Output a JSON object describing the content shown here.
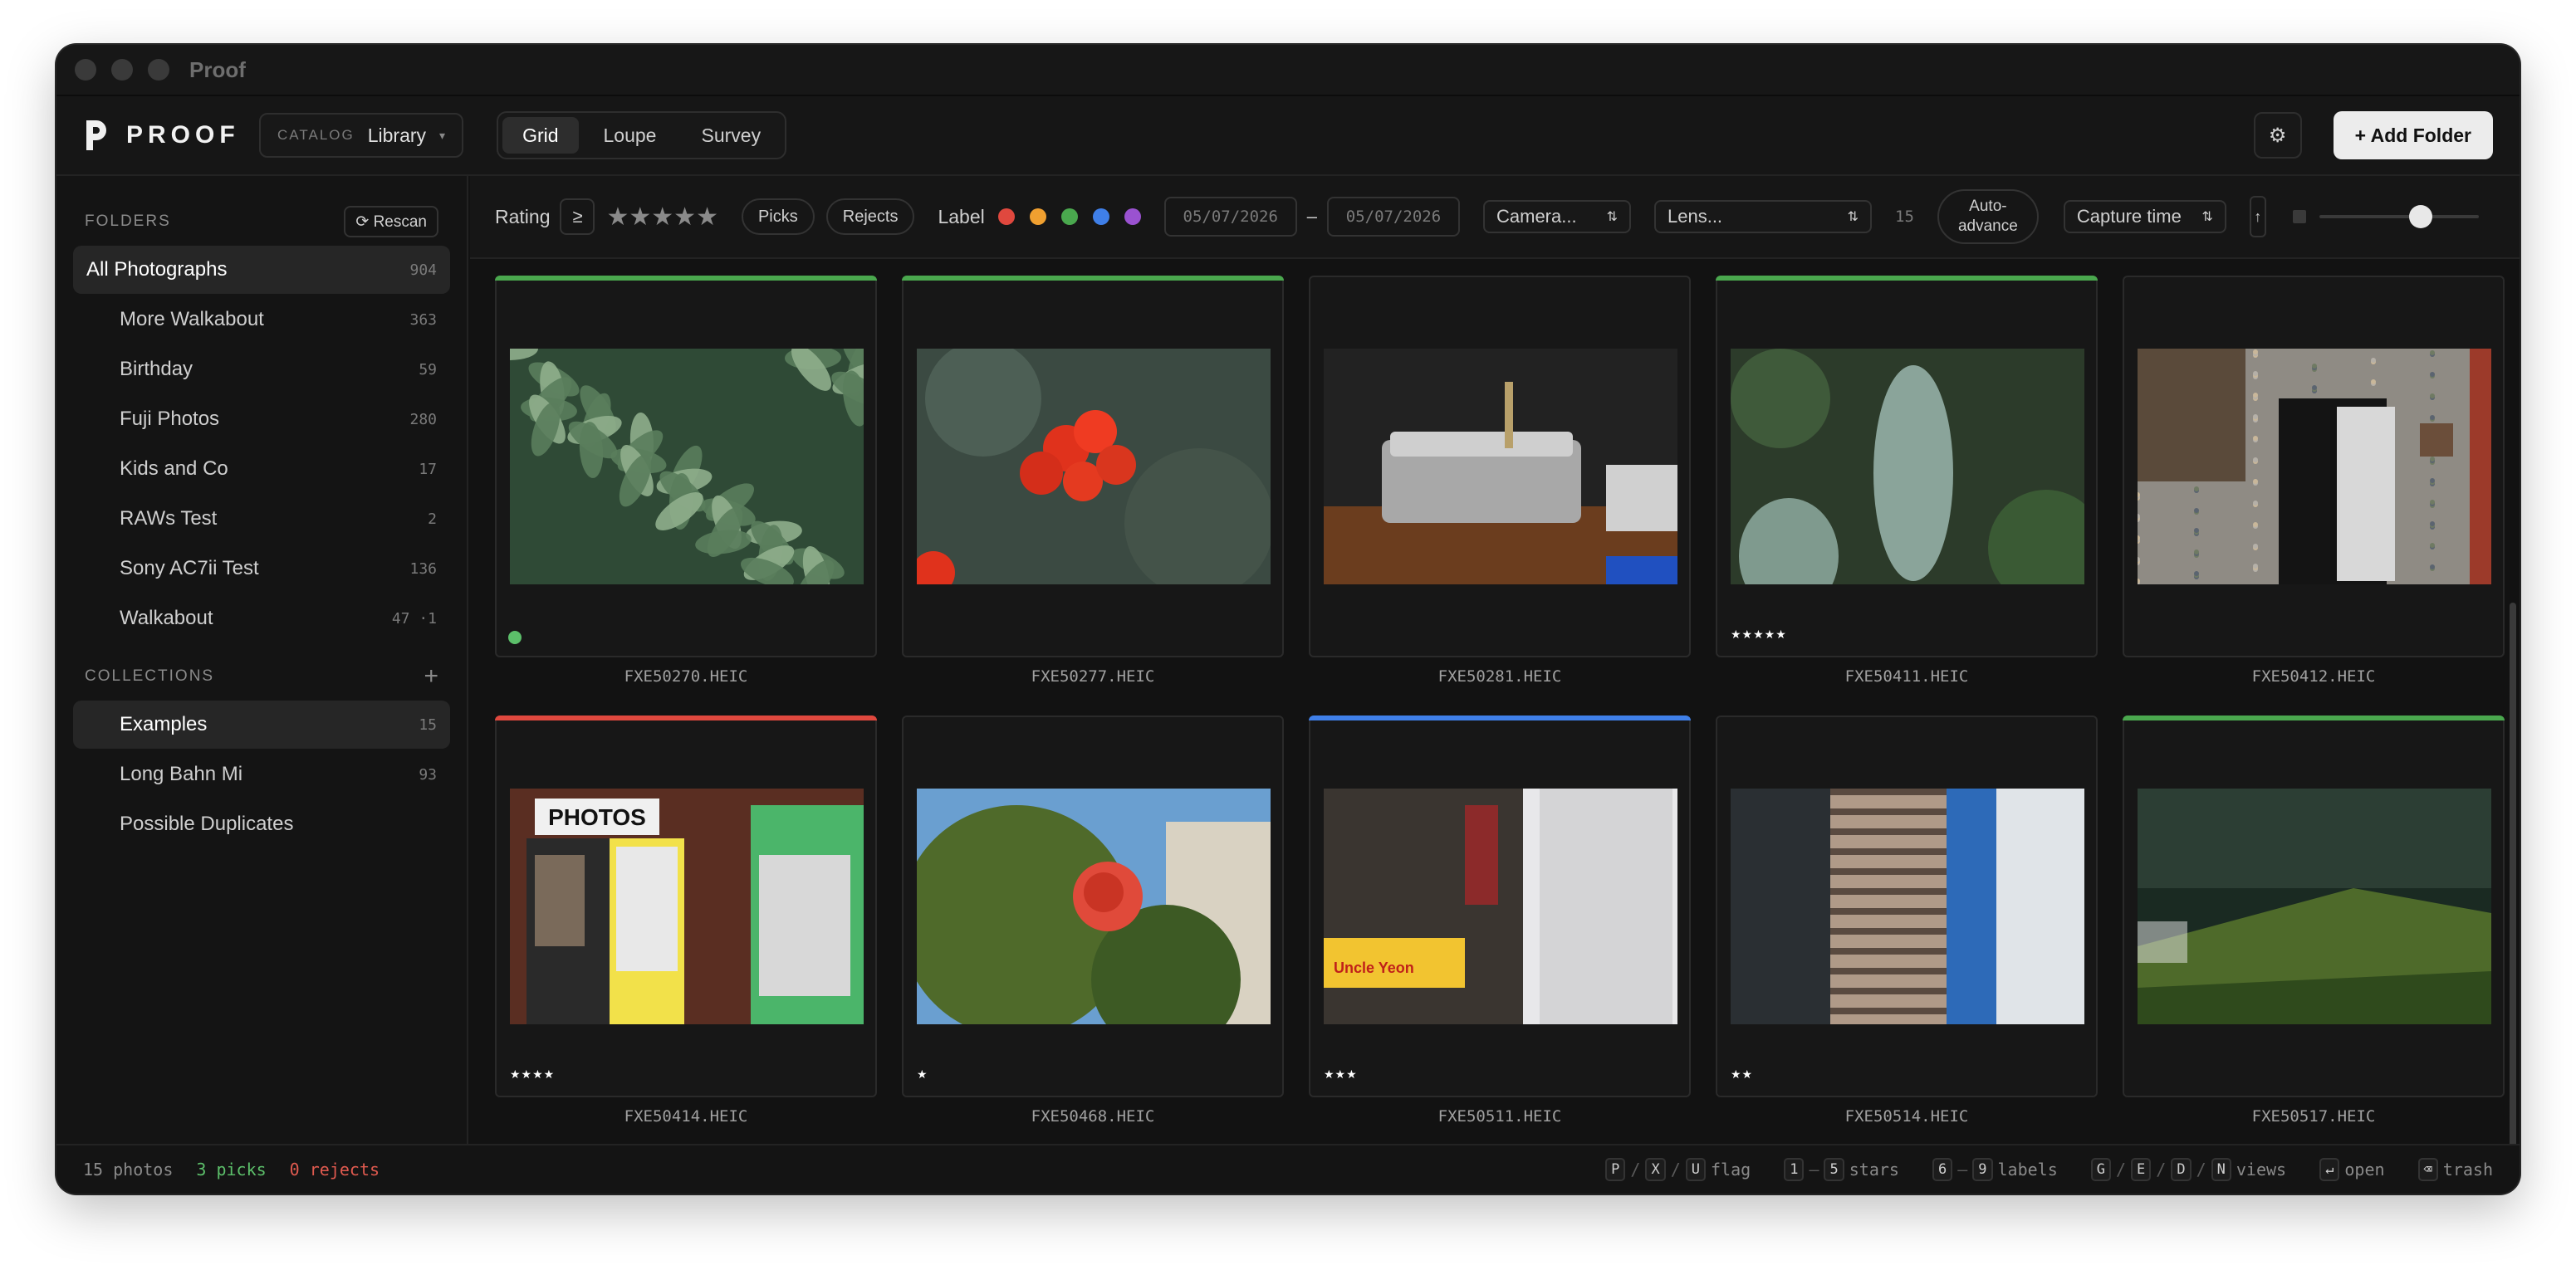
{
  "window": {
    "title": "Proof"
  },
  "toolbar": {
    "logo_text": "PROOF",
    "catalog_caption": "CATALOG",
    "catalog_value": "Library",
    "views": [
      "Grid",
      "Loupe",
      "Survey"
    ],
    "active_view": "Grid",
    "add_folder_label": "+ Add Folder",
    "settings_icon": "gear-icon"
  },
  "sidebar": {
    "folders_heading": "FOLDERS",
    "rescan_label": "⟳ Rescan",
    "folders": [
      {
        "label": "All Photographs",
        "count": "904",
        "active": true
      },
      {
        "label": "More Walkabout",
        "count": "363"
      },
      {
        "label": "Birthday",
        "count": "59"
      },
      {
        "label": "Fuji Photos",
        "count": "280"
      },
      {
        "label": "Kids and Co",
        "count": "17"
      },
      {
        "label": "RAWs Test",
        "count": "2"
      },
      {
        "label": "Sony AC7ii Test",
        "count": "136"
      },
      {
        "label": "Walkabout",
        "count": "47 ·1"
      }
    ],
    "collections_heading": "COLLECTIONS",
    "collections_add": "+",
    "collections": [
      {
        "label": "Examples",
        "count": "15",
        "active": true
      },
      {
        "label": "Long Bahn Mi",
        "count": "93"
      },
      {
        "label": "Possible Duplicates",
        "count": ""
      }
    ]
  },
  "filters": {
    "rating_label": "Rating",
    "rating_op": "≥",
    "rating_stars": "★★★★★",
    "picks_label": "Picks",
    "rejects_label": "Rejects",
    "label_label": "Label",
    "label_colors": [
      "#e0483e",
      "#f0a030",
      "#4aa84e",
      "#3f7fe8",
      "#9a52d0"
    ],
    "date_from": "05/07/2026",
    "date_to": "05/07/2026",
    "date_sep": "–",
    "camera_placeholder": "Camera...",
    "lens_placeholder": "Lens...",
    "result_count": "15",
    "auto_advance_line1": "Auto-",
    "auto_advance_line2": "advance",
    "sort_label": "Capture time",
    "sort_dir": "↑",
    "thumb_size_level": 0.22
  },
  "photos": [
    {
      "filename": "FXE50270.HEIC",
      "label_color": "#4aa84e",
      "stars": "",
      "flag": "pick"
    },
    {
      "filename": "FXE50277.HEIC",
      "label_color": "#4aa84e",
      "stars": "",
      "flag": ""
    },
    {
      "filename": "FXE50281.HEIC",
      "label_color": "",
      "stars": "",
      "flag": ""
    },
    {
      "filename": "FXE50411.HEIC",
      "label_color": "#4aa84e",
      "stars": "★★★★★",
      "flag": ""
    },
    {
      "filename": "FXE50412.HEIC",
      "label_color": "",
      "stars": "",
      "flag": ""
    },
    {
      "filename": "FXE50414.HEIC",
      "label_color": "#e0483e",
      "stars": "★★★★",
      "flag": ""
    },
    {
      "filename": "FXE50468.HEIC",
      "label_color": "",
      "stars": "★",
      "flag": ""
    },
    {
      "filename": "FXE50511.HEIC",
      "label_color": "#3f7fe8",
      "stars": "★★★",
      "flag": ""
    },
    {
      "filename": "FXE50514.HEIC",
      "label_color": "",
      "stars": "★★",
      "flag": ""
    },
    {
      "filename": "FXE50517.HEIC",
      "label_color": "#4aa84e",
      "stars": "",
      "flag": ""
    }
  ],
  "status": {
    "photos": "15 photos",
    "picks": "3 picks",
    "rejects": "0 rejects",
    "hints": [
      {
        "keys": [
          "P",
          "X",
          "U"
        ],
        "joiner": "/",
        "label": "flag"
      },
      {
        "keys": [
          "1",
          "5"
        ],
        "joiner": "–",
        "label": "stars"
      },
      {
        "keys": [
          "6",
          "9"
        ],
        "joiner": "–",
        "label": "labels"
      },
      {
        "keys": [
          "G",
          "E",
          "D",
          "N"
        ],
        "joiner": "/",
        "label": "views"
      },
      {
        "keys": [
          "↵"
        ],
        "joiner": "",
        "label": "open"
      },
      {
        "keys": [
          "⌫"
        ],
        "joiner": "",
        "label": "trash"
      }
    ]
  }
}
